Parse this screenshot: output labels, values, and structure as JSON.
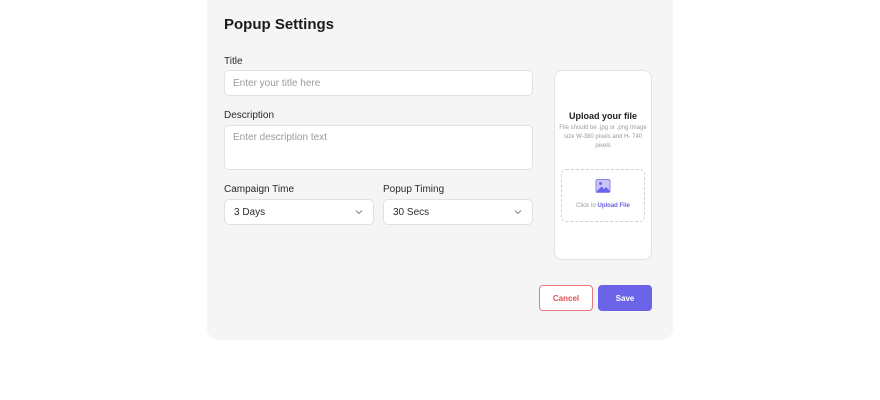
{
  "popup": {
    "heading": "Popup Settings",
    "title_label": "Title",
    "title_placeholder": "Enter your title here",
    "description_label": "Description",
    "description_placeholder": "Enter description text",
    "campaign_label": "Campaign Time",
    "campaign_value": "3 Days",
    "timing_label": "Popup Timing",
    "timing_value": "30 Secs"
  },
  "upload": {
    "title": "Upload your file",
    "hint": "File should be .jpg or .png Image size W-380 pixels and H- 740 pixels",
    "click_text": "Click to ",
    "link_text": "Upload File"
  },
  "actions": {
    "cancel_label": "Cancel",
    "save_label": "Save"
  },
  "colors": {
    "accent": "#6b63e8",
    "cancel": "#e05252",
    "card_bg": "#f5f5f5"
  },
  "icons": {
    "select_chevron": "chevron-down-icon",
    "upload_image": "image-icon"
  }
}
